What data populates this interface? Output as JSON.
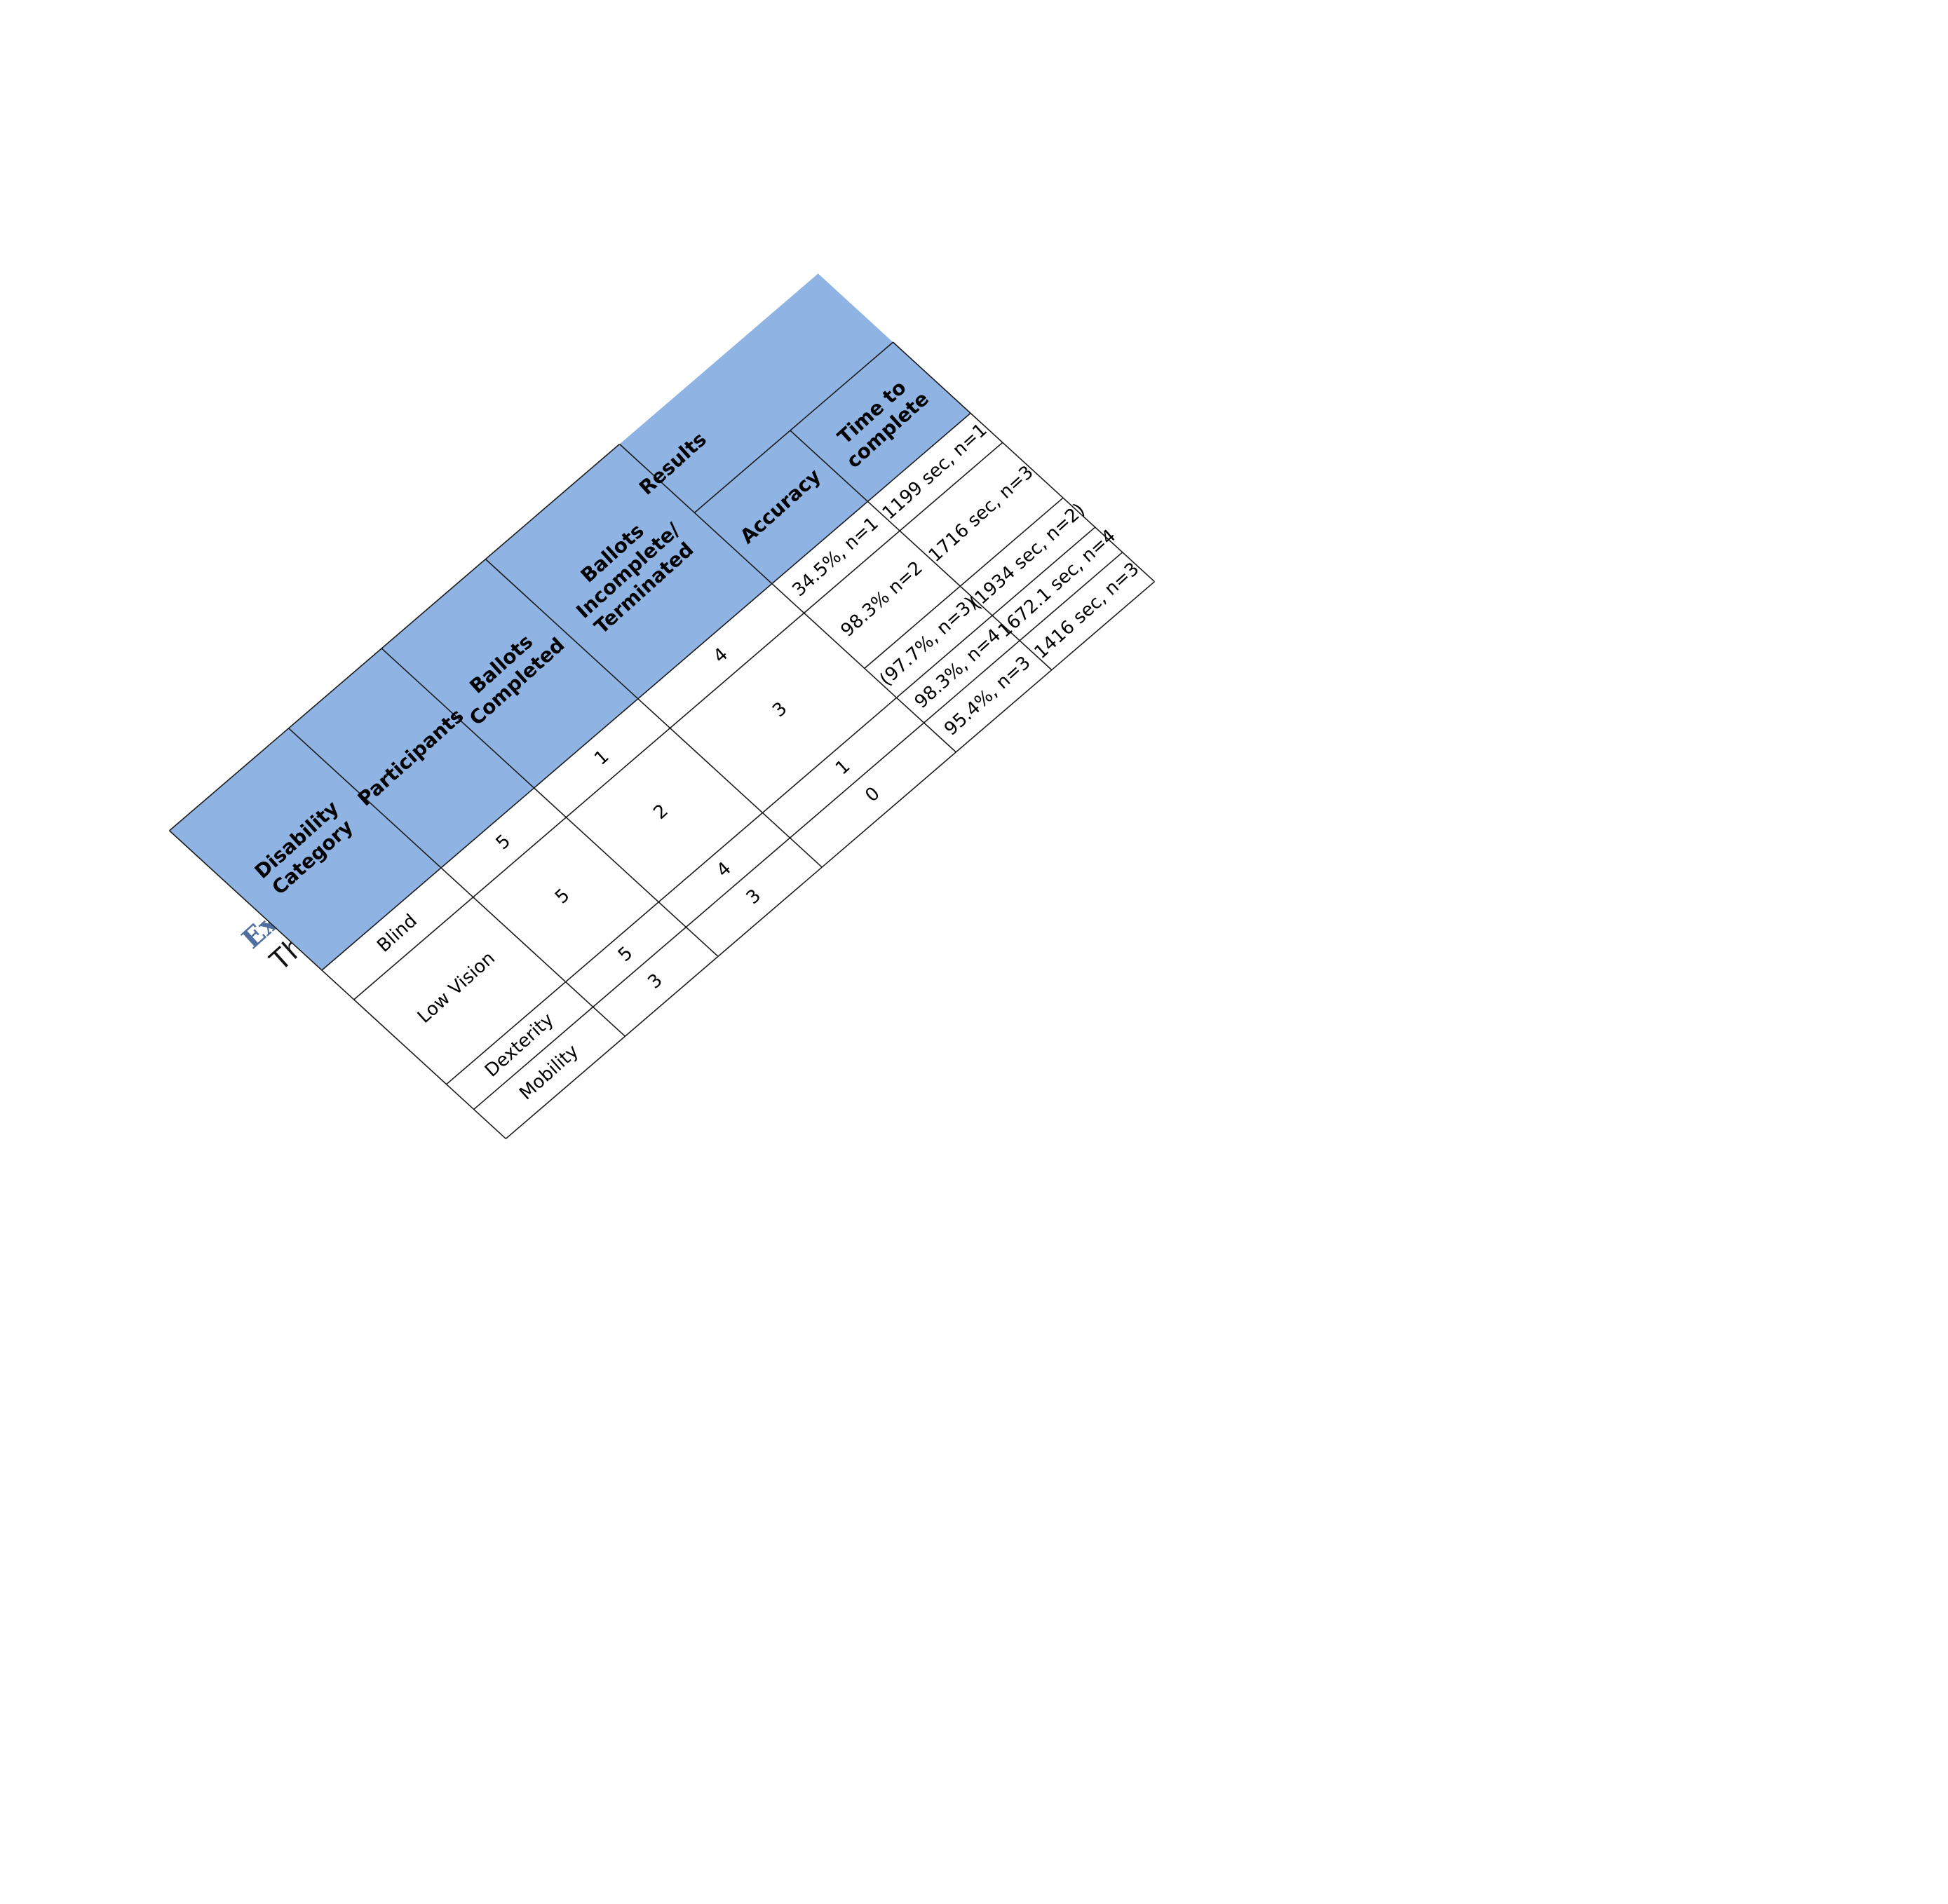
{
  "document": {
    "title": "Example table",
    "caption": "This is an example of a data table."
  },
  "table": {
    "header_fill": "#8fb3e3",
    "line_color": "#1a1a1a",
    "group_header": "Results",
    "columns": [
      [
        "Disability",
        "Category"
      ],
      [
        "Participants"
      ],
      [
        "Ballots",
        "Completed"
      ],
      [
        "Ballots",
        "Incomplete/",
        "Terminated"
      ],
      [
        "Accuracy"
      ],
      [
        "Time to",
        "complete"
      ]
    ],
    "rows": [
      [
        "Blind",
        "5",
        "1",
        "4",
        "34.5%, n=1",
        "1199 sec, n=1"
      ],
      [
        "Low Vision",
        "5",
        "2",
        "3",
        "98.3% n=2",
        "1716 sec, n=3"
      ],
      [
        "",
        "",
        "",
        "",
        "(97.7%, n=3)",
        "(1934 sec, n=2)"
      ],
      [
        "Dexterity",
        "5",
        "4",
        "1",
        "98.3%, n=4",
        "1672.1 sec, n=4"
      ],
      [
        "Mobility",
        "3",
        "3",
        "0",
        "95.4%, n=3",
        "1416 sec, n=3"
      ]
    ]
  }
}
